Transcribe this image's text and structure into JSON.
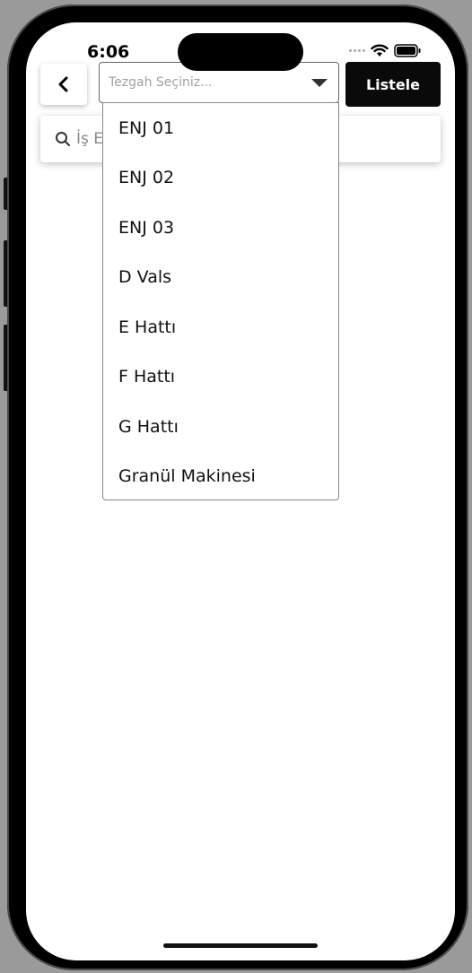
{
  "status_bar": {
    "time": "6:06"
  },
  "top_bar": {
    "back_icon": "chevron-left-icon",
    "machine_select_placeholder": "Tezgah Seçiniz...",
    "list_button_label": "Listele"
  },
  "search": {
    "placeholder_visible": "İş E",
    "icon": "search-icon"
  },
  "dropdown": {
    "options": [
      "ENJ 01",
      "ENJ 02",
      "ENJ 03",
      "D Vals",
      "E Hattı",
      "F Hattı",
      "G Hattı",
      "Granül Makinesi"
    ]
  }
}
